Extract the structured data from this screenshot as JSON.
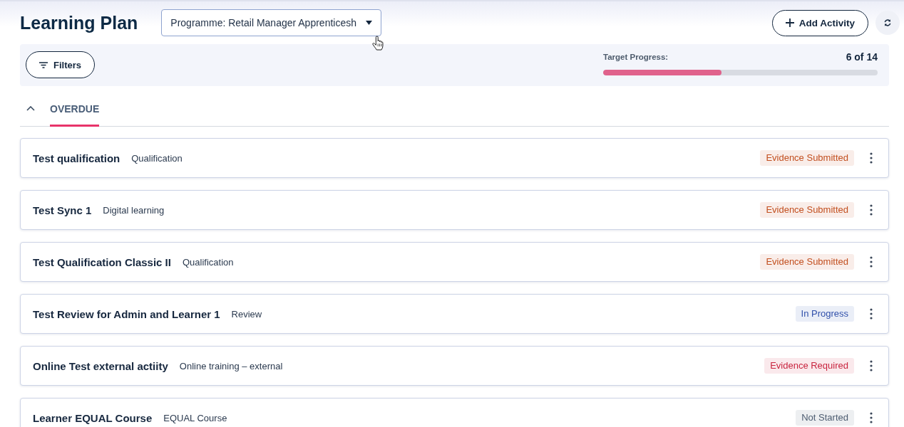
{
  "page": {
    "title": "Learning Plan"
  },
  "programme_select": {
    "value": "Programme: Retail Manager Apprenticesh"
  },
  "actions": {
    "add_activity": "Add Activity"
  },
  "filters": {
    "button": "Filters"
  },
  "target_progress": {
    "label": "Target Progress:",
    "reading": "6 of 14",
    "level": 0.43
  },
  "sections": [
    {
      "label": "OVERDUE",
      "expanded": true,
      "activities": [
        {
          "title": "Test qualification",
          "type": "Qualification",
          "status": {
            "label": "Evidence Submitted",
            "color": "#c24f1f"
          }
        },
        {
          "title": "Test Sync 1",
          "type": "Digital learning",
          "status": {
            "label": "Evidence Submitted",
            "color": "#c24f1f"
          }
        },
        {
          "title": "Test Qualification Classic II",
          "type": "Qualification",
          "status": {
            "label": "Evidence Submitted",
            "color": "#c24f1f"
          }
        },
        {
          "title": "Test Review for Admin and Learner 1",
          "type": "Review",
          "status": {
            "label": "In Progress",
            "color": "#3050aa"
          }
        },
        {
          "title": "Online Test external actiity",
          "type": "Online training – external",
          "status": {
            "label": "Evidence Required",
            "color": "#c8243f"
          }
        },
        {
          "title": "Learner EQUAL Course",
          "type": "EQUAL Course",
          "status": {
            "label": "Not Started",
            "color": "#4c5c70"
          }
        }
      ]
    }
  ]
}
